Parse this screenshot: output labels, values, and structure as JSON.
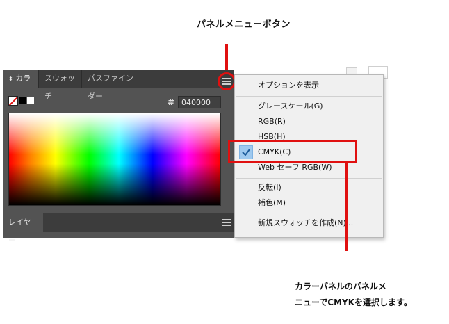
{
  "callouts": {
    "top": "パネルメニューボタン",
    "bottom_line1": "カラーパネルのパネルメ",
    "bottom_line2": "ニューでCMYKを選択します。"
  },
  "panel": {
    "tabs": [
      "カラー",
      "スウォッチ",
      "パスファインダー"
    ],
    "hex_label": "#",
    "hex_value": "040000",
    "layers_tab": "レイヤー"
  },
  "menu": {
    "items": [
      {
        "label": "オプションを表示"
      },
      {
        "label": "グレースケール(G)"
      },
      {
        "label": "RGB(R)"
      },
      {
        "label": "HSB(H)"
      },
      {
        "label": "CMYK(C)",
        "checked": true
      },
      {
        "label": "Web セーフ RGB(W)"
      },
      {
        "label": "反転(I)"
      },
      {
        "label": "補色(M)"
      },
      {
        "label": "新規スウォッチを作成(N)..."
      }
    ]
  },
  "colors": {
    "highlight": "#e01010",
    "panel_bg": "#535353",
    "tab_bar": "#3c3c3c",
    "menu_bg": "#f0f0f0",
    "check_bg": "#9ec9ef"
  },
  "icons": [
    "menu-lines-icon",
    "checkmark-icon",
    "collapse-arrows-icon",
    "fill-stroke-swatch-icon"
  ]
}
